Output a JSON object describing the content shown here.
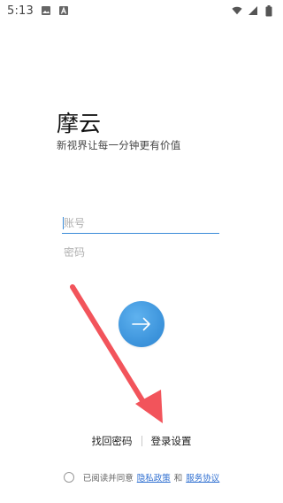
{
  "status_bar": {
    "time": "5:13",
    "icons_left": [
      "image-icon",
      "a-icon"
    ],
    "icons_right": [
      "wifi-icon",
      "signal-icon",
      "battery-icon"
    ]
  },
  "brand": {
    "title": "摩云",
    "subtitle": "新视界让每一分钟更有价值"
  },
  "form": {
    "account_placeholder": "账号",
    "password_placeholder": "密码"
  },
  "login_button": {
    "icon": "arrow-right-icon",
    "color": "#3f96dd"
  },
  "links": {
    "forgot_password": "找回密码",
    "login_settings": "登录设置"
  },
  "agreement": {
    "prefix": "已阅读并同意",
    "privacy_policy": "隐私政策",
    "and": "和",
    "service_agreement": "服务协议"
  },
  "colors": {
    "accent": "#3a8bd8",
    "annotation_arrow": "#f2545b",
    "link": "#2f6fd1"
  }
}
